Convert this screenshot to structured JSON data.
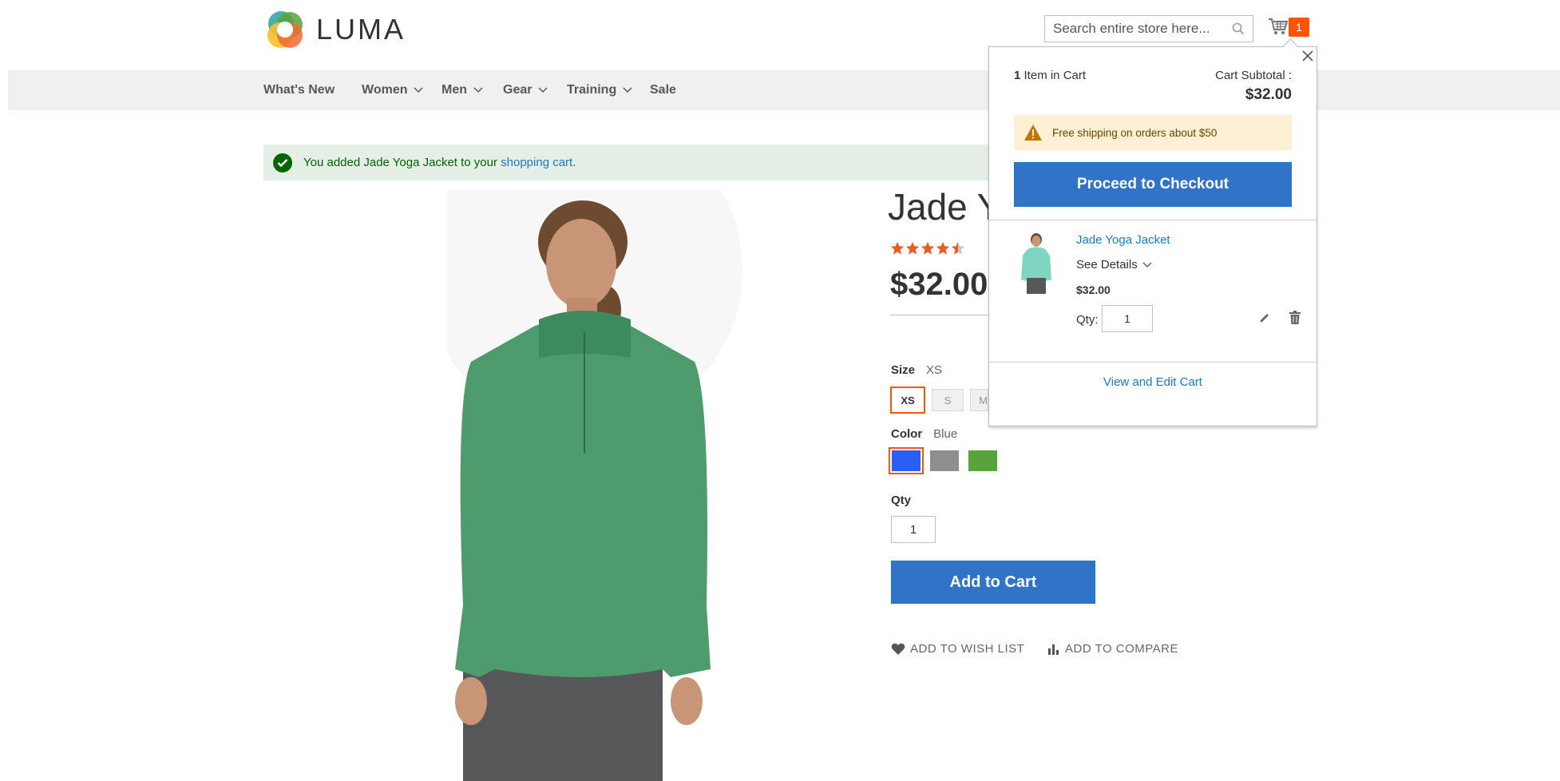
{
  "brand": {
    "name": "LUMA"
  },
  "search": {
    "placeholder": "Search entire store here..."
  },
  "cart": {
    "count": "1"
  },
  "nav": [
    {
      "label": "What's New",
      "has_dropdown": false
    },
    {
      "label": "Women",
      "has_dropdown": true
    },
    {
      "label": "Men",
      "has_dropdown": true
    },
    {
      "label": "Gear",
      "has_dropdown": true
    },
    {
      "label": "Training",
      "has_dropdown": true
    },
    {
      "label": "Sale",
      "has_dropdown": false
    }
  ],
  "message": {
    "prefix": "You added Jade Yoga Jacket to your ",
    "link": "shopping cart",
    "suffix": "."
  },
  "product": {
    "title": "Jade Yoga Jacket",
    "rating": 4.5,
    "price": "$32.00",
    "size_label": "Size",
    "size_selected": "XS",
    "sizes": [
      "XS",
      "S",
      "M"
    ],
    "color_label": "Color",
    "color_selected": "Blue",
    "colors": [
      "#2a5ff5",
      "#8e8e8e",
      "#5aa23a"
    ],
    "qty_label": "Qty",
    "qty_value": "1",
    "add_to_cart": "Add to Cart",
    "wishlist": "ADD TO WISH LIST",
    "compare": "ADD TO COMPARE"
  },
  "minicart": {
    "items_count": "1",
    "items_label": " Item in Cart",
    "subtotal_label": "Cart Subtotal :",
    "subtotal": "$32.00",
    "notice": "Free shipping on orders about $50",
    "checkout": "Proceed to Checkout",
    "item": {
      "name": "Jade Yoga Jacket",
      "details": "See Details",
      "price": "$32.00",
      "qty_label": "Qty:",
      "qty": "1"
    },
    "view_cart": "View and Edit Cart"
  },
  "colors": {
    "accent": "#1979c3",
    "button": "#3174c7",
    "badge": "#ff5501",
    "star": "#e85d22"
  }
}
